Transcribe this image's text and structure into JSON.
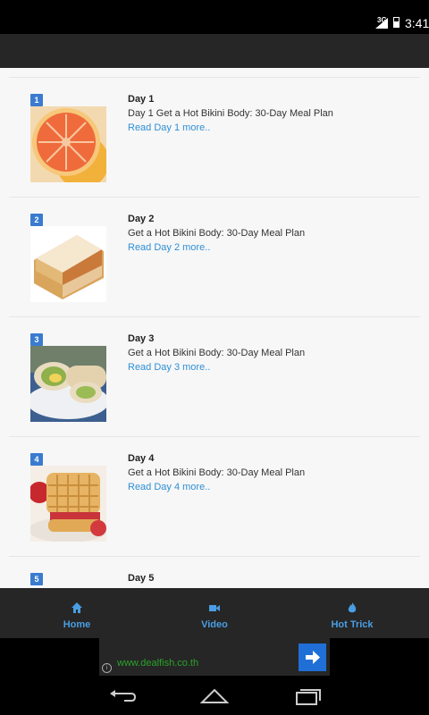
{
  "status_bar": {
    "network": "3G",
    "time": "3:41"
  },
  "items": [
    {
      "badge": "1",
      "title": "Day 1",
      "description": "Day 1 Get a Hot Bikini Body: 30-Day Meal Plan",
      "link": "Read Day 1 more..",
      "image": "grapefruit"
    },
    {
      "badge": "2",
      "title": "Day 2",
      "description": "Get a Hot Bikini Body: 30-Day Meal Plan",
      "link": "Read Day 2 more..",
      "image": "sandwich"
    },
    {
      "badge": "3",
      "title": "Day 3",
      "description": "Get a Hot Bikini Body: 30-Day Meal Plan",
      "link": "Read Day 3 more..",
      "image": "wrap"
    },
    {
      "badge": "4",
      "title": "Day 4",
      "description": "Get a Hot Bikini Body: 30-Day Meal Plan",
      "link": "Read Day 4 more..",
      "image": "waffle"
    },
    {
      "badge": "5",
      "title": "Day 5"
    }
  ],
  "bottom_nav": [
    {
      "label": "Home",
      "icon": "home-icon"
    },
    {
      "label": "Video",
      "icon": "video-camera-icon"
    },
    {
      "label": "Hot Trick",
      "icon": "flame-icon"
    }
  ],
  "ad": {
    "url": "www.dealfish.co.th",
    "info": "i",
    "arrow_icon": "arrow-right-icon"
  },
  "colors": {
    "accent": "#2f8fd6",
    "badge": "#3a7bd0",
    "bar": "#262626",
    "ad_url": "#29a329"
  }
}
